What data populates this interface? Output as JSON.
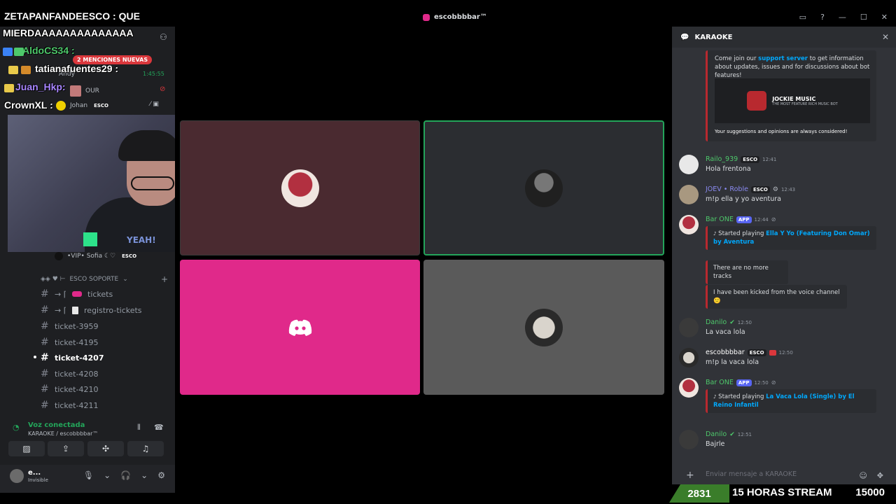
{
  "titlebar": {
    "server_name": "escobbbbar™"
  },
  "overlay_chat": {
    "first_line": "ZETAPANFANDEESCO : QUE",
    "second_line": "MIERDAAAAAAAAAAAAAA",
    "users": [
      {
        "name": "AldoCS34 :",
        "color": "#4ec86b"
      },
      {
        "name": "tatianafuentes29 :",
        "color": "#ffffff"
      },
      {
        "name": "Juan_Hkp:",
        "color": "#a886ff"
      },
      {
        "name": "CrownXL :",
        "color": "#ffffff"
      }
    ]
  },
  "sidebar": {
    "server_label": "escobbbbar",
    "mentions_pill": "2 MENCIONES NUEVAS",
    "timestamp": "1:45:55",
    "voice_users": [
      {
        "name": "Andy"
      },
      {
        "name": "OUR"
      },
      {
        "name": "Johan",
        "tag": "ESCO"
      },
      {
        "name": "•VIP• Sofia ☾♡",
        "tag": "ESCO"
      }
    ],
    "category": "ESCO SOPORTE",
    "channels": [
      {
        "name": "tickets",
        "prefix": "→ ⌈"
      },
      {
        "name": "registro-tickets",
        "prefix": "→ ⌈"
      },
      {
        "name": "ticket-3959"
      },
      {
        "name": "ticket-4195"
      },
      {
        "name": "ticket-4207",
        "active": true
      },
      {
        "name": "ticket-4208"
      },
      {
        "name": "ticket-4210"
      },
      {
        "name": "ticket-4211"
      }
    ],
    "voice_panel": {
      "status": "Voz conectada",
      "location": "KARAOKE / escobbbbar™"
    },
    "user_panel": {
      "name": "e...",
      "status": "Invisible"
    }
  },
  "webcam": {
    "shirt_text": "YEAH!"
  },
  "stage": {
    "tiles": [
      {
        "kind": "bot-avatar"
      },
      {
        "kind": "girl-avatar",
        "speaking": true
      },
      {
        "kind": "discord-logo"
      },
      {
        "kind": "dog-avatar"
      }
    ]
  },
  "chat": {
    "channel_name": "KARAOKE",
    "embed": {
      "text_before": "Come join our ",
      "link": "support server",
      "text_after": " to get information about updates, issues and for discussions about bot features!",
      "logo_title": "JOCKIE MUSIC",
      "logo_sub": "THE MOST FEATURE RICH MUSIC BOT",
      "footer": "Your suggestions and opinions are always considered!"
    },
    "messages": [
      {
        "author": "Railo_939",
        "author_color": "#4ec86b",
        "tag": "ESCO",
        "time": "12:41",
        "text": "Hola frentona"
      },
      {
        "author": "JOEV • Roble",
        "author_color": "#8a8af0",
        "tag": "ESCO",
        "time": "12:43",
        "text": "m!p ella y yo aventura"
      },
      {
        "author": "Bar ONE",
        "author_color": "#4ec86b",
        "tag": "APP",
        "time": "12:44",
        "embed_prefix": "Started playing ",
        "embed_link": "Ella Y Yo (Featuring Don Omar) by Aventura"
      },
      {
        "notice_1": "There are no more tracks",
        "notice_2": "I have been kicked from the voice channel 🙁"
      },
      {
        "author": "Danilo",
        "author_color": "#4ec86b",
        "time": "12:50",
        "text": "La vaca lola"
      },
      {
        "author": "escobbbbar",
        "author_color": "#ffffff",
        "tag": "ESCO",
        "time": "12:50",
        "text": "m!p la vaca lola"
      },
      {
        "author": "Bar ONE",
        "author_color": "#4ec86b",
        "tag": "APP",
        "time": "12:50",
        "embed_prefix": "Started playing ",
        "embed_link": "La Vaca Lola (Single) by El Reino Infantil"
      },
      {
        "author": "Danilo",
        "author_color": "#4ec86b",
        "time": "12:51",
        "text": "Bajrle"
      }
    ],
    "input_placeholder": "Enviar mensaje a KARAOKE"
  },
  "stream_bar": {
    "count": "2831",
    "label": "15 HORAS STREAM",
    "goal": "15000"
  }
}
